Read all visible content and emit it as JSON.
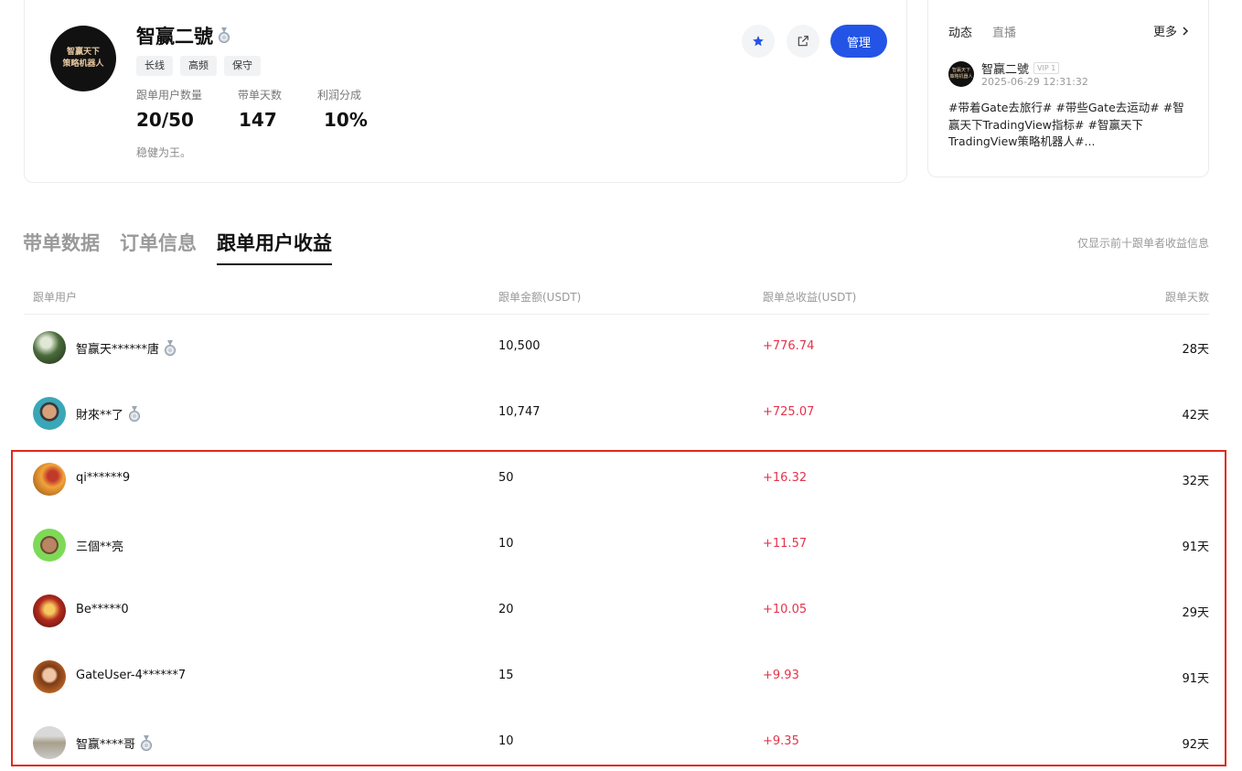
{
  "profile": {
    "avatar_line1": "智赢天下",
    "avatar_line2": "策略机器人",
    "name": "智赢二號",
    "tags": [
      "长线",
      "高频",
      "保守"
    ],
    "stats": [
      {
        "label": "跟单用户数量",
        "value": "20/50"
      },
      {
        "label": "带单天数",
        "value": "147"
      },
      {
        "label": "利润分成",
        "value": "10%"
      }
    ],
    "description": "稳健为王。",
    "manage_label": "管理",
    "accent_color": "#2354e6"
  },
  "feed": {
    "tabs": [
      "动态",
      "直播"
    ],
    "more_label": "更多",
    "post": {
      "avatar_line1": "智赢天下",
      "avatar_line2": "策略机器人",
      "author": "智赢二號",
      "badge": "VIP 1",
      "time": "2025-06-29 12:31:32",
      "text": "#带着Gate去旅行# #带些Gate去运动# #智赢天下TradingView指标# #智赢天下TradingView策略机器人#..."
    }
  },
  "tabs": [
    "带单数据",
    "订单信息",
    "跟单用户收益"
  ],
  "note": "仅显示前十跟单者收益信息",
  "table": {
    "headers": {
      "user": "跟单用户",
      "amount": "跟单金额(USDT)",
      "profit": "跟单总收益(USDT)",
      "days": "跟单天数"
    },
    "rows": [
      {
        "user": "智赢天******唐",
        "medal": true,
        "amount": "10,500",
        "profit": "+776.74",
        "days": "28天",
        "avatar": "green-landscape"
      },
      {
        "user": "財來**了",
        "medal": true,
        "amount": "10,747",
        "profit": "+725.07",
        "days": "42天",
        "avatar": "teal-portrait"
      },
      {
        "user": "qi******9",
        "medal": false,
        "amount": "50",
        "profit": "+16.32",
        "days": "32天",
        "avatar": "orange-poster"
      },
      {
        "user": "三個**亮",
        "medal": false,
        "amount": "10",
        "profit": "+11.57",
        "days": "91天",
        "avatar": "lime-portrait"
      },
      {
        "user": "Be*****0",
        "medal": false,
        "amount": "20",
        "profit": "+10.05",
        "days": "29天",
        "avatar": "red-warrior"
      },
      {
        "user": "GateUser-4******7",
        "medal": false,
        "amount": "15",
        "profit": "+9.93",
        "days": "91天",
        "avatar": "orange-portrait"
      },
      {
        "user": "智赢****哥",
        "medal": true,
        "amount": "10",
        "profit": "+9.35",
        "days": "92天",
        "avatar": "grey-poster"
      }
    ]
  }
}
